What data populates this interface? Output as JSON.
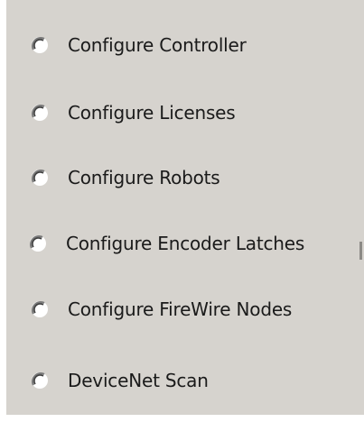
{
  "options": [
    {
      "id": "configure-controller",
      "label": "Configure Controller",
      "selected": false
    },
    {
      "id": "configure-licenses",
      "label": "Configure Licenses",
      "selected": false
    },
    {
      "id": "configure-robots",
      "label": "Configure Robots",
      "selected": false
    },
    {
      "id": "configure-encoder-latches",
      "label": "Configure Encoder Latches",
      "selected": false
    },
    {
      "id": "configure-firewire-nodes",
      "label": "Configure FireWire Nodes",
      "selected": false
    },
    {
      "id": "devicenet-scan",
      "label": "DeviceNet Scan",
      "selected": false
    }
  ],
  "colors": {
    "panel_bg": "#d6d3ce",
    "radio_fill": "#ffffff",
    "radio_shadow": "#808080",
    "text": "#1a1a1a"
  },
  "icons": {
    "radio": "radio-unchecked-icon"
  }
}
